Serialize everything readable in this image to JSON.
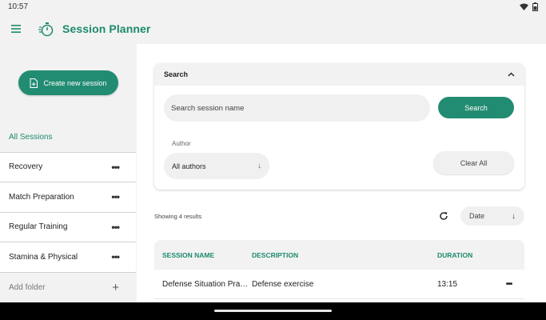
{
  "status_bar": {
    "time": "10:57"
  },
  "app_bar": {
    "title": "Session Planner"
  },
  "sidebar": {
    "create_label": "Create new session",
    "items": [
      {
        "label": "All Sessions"
      },
      {
        "label": "Recovery"
      },
      {
        "label": "Match Preparation"
      },
      {
        "label": "Regular Training"
      },
      {
        "label": "Stamina & Physical"
      }
    ],
    "add_folder_label": "Add folder"
  },
  "search": {
    "title": "Search",
    "input_placeholder": "Search session name",
    "button_label": "Search",
    "author_label": "Author",
    "author_value": "All authors",
    "clear_label": "Clear All"
  },
  "results": {
    "count_text": "Showing 4 results",
    "sort_value": "Date"
  },
  "table": {
    "headers": [
      "SESSION NAME",
      "DESCRIPTION",
      "DURATION"
    ],
    "rows": [
      {
        "name": "Defense Situation Practice",
        "description": "Defense exercise",
        "duration": "13:15"
      }
    ]
  },
  "colors": {
    "accent": "#228c72",
    "accent_text": "#1d8a6e"
  }
}
